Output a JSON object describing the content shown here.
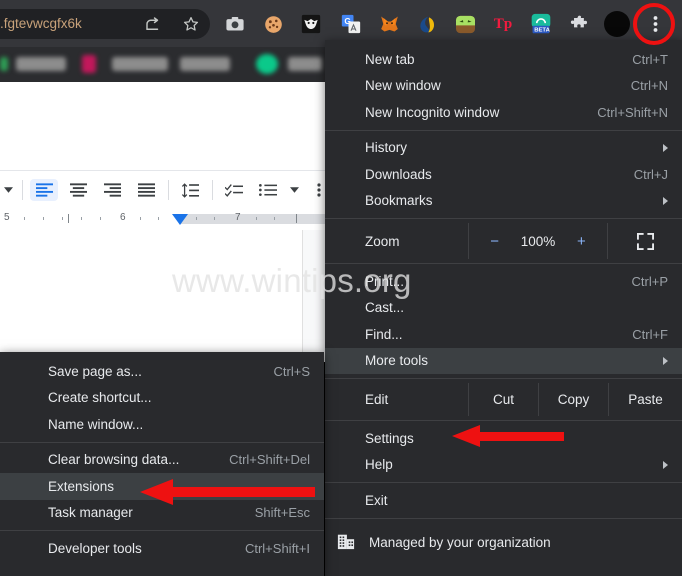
{
  "browser": {
    "omnibox_text": ".fgtevwcgfx6k",
    "toolbar_icons": [
      {
        "name": "share-icon",
        "glyph": "↪"
      },
      {
        "name": "bookmark-star-icon",
        "glyph": "☆"
      },
      {
        "name": "screenshot-camera-icon",
        "glyph": "▣"
      },
      {
        "name": "cookie-extension-icon",
        "glyph": "●"
      },
      {
        "name": "owl-extension-icon",
        "glyph": "▼"
      },
      {
        "name": "google-translate-icon",
        "glyph": "G"
      },
      {
        "name": "metamask-fox-icon",
        "glyph": "◆"
      },
      {
        "name": "wallet-extension-icon",
        "glyph": "◖"
      },
      {
        "name": "green-monster-extension-icon",
        "glyph": "▬"
      },
      {
        "name": "tp-extension-icon",
        "glyph": "Tp"
      },
      {
        "name": "beta-extension-icon",
        "glyph": "BETA"
      },
      {
        "name": "extensions-puzzle-icon",
        "glyph": "❖"
      },
      {
        "name": "profile-avatar-icon",
        "glyph": ""
      },
      {
        "name": "chrome-three-dot-menu-icon",
        "glyph": "⋮"
      }
    ]
  },
  "docs": {
    "toolbar_tools": [
      {
        "name": "align-left-button",
        "active": true
      },
      {
        "name": "align-center-button",
        "active": false
      },
      {
        "name": "align-right-button",
        "active": false
      },
      {
        "name": "justify-button",
        "active": false
      },
      {
        "name": "line-spacing-button",
        "active": false
      },
      {
        "name": "checklist-button",
        "active": false
      },
      {
        "name": "bulleted-list-button",
        "active": false
      }
    ],
    "ruler_marks": [
      "5",
      "6",
      "7"
    ]
  },
  "watermark": "www.wintips.org",
  "main_menu": {
    "groups": [
      {
        "items": [
          {
            "label": "New tab",
            "accel": "Ctrl+T",
            "submenu": false,
            "highlighted": false
          },
          {
            "label": "New window",
            "accel": "Ctrl+N",
            "submenu": false,
            "highlighted": false
          },
          {
            "label": "New Incognito window",
            "accel": "Ctrl+Shift+N",
            "submenu": false,
            "highlighted": false
          }
        ]
      },
      {
        "items": [
          {
            "label": "History",
            "accel": "",
            "submenu": true,
            "highlighted": false
          },
          {
            "label": "Downloads",
            "accel": "Ctrl+J",
            "submenu": false,
            "highlighted": false
          },
          {
            "label": "Bookmarks",
            "accel": "",
            "submenu": true,
            "highlighted": false
          }
        ]
      }
    ],
    "zoom_row": {
      "label": "Zoom",
      "minus": "−",
      "value": "100%",
      "plus": "+",
      "fullscreen_icon": "fullscreen-icon"
    },
    "group3": {
      "items": [
        {
          "label": "Print...",
          "accel": "Ctrl+P",
          "submenu": false,
          "highlighted": false
        },
        {
          "label": "Cast...",
          "accel": "",
          "submenu": false,
          "highlighted": false
        },
        {
          "label": "Find...",
          "accel": "Ctrl+F",
          "submenu": false,
          "highlighted": false
        },
        {
          "label": "More tools",
          "accel": "",
          "submenu": true,
          "highlighted": true
        }
      ]
    },
    "edit_row": {
      "edit": "Edit",
      "cut": "Cut",
      "copy": "Copy",
      "paste": "Paste"
    },
    "group4": {
      "items": [
        {
          "label": "Settings",
          "accel": "",
          "submenu": false,
          "highlighted": false
        },
        {
          "label": "Help",
          "accel": "",
          "submenu": true,
          "highlighted": false
        }
      ]
    },
    "group5": {
      "items": [
        {
          "label": "Exit",
          "accel": "",
          "submenu": false,
          "highlighted": false
        }
      ]
    },
    "managed": {
      "label": "Managed by your organization",
      "icon": "organization-building-icon"
    }
  },
  "sub_menu": {
    "groups": [
      {
        "items": [
          {
            "label": "Save page as...",
            "accel": "Ctrl+S",
            "highlighted": false
          },
          {
            "label": "Create shortcut...",
            "accel": "",
            "highlighted": false
          },
          {
            "label": "Name window...",
            "accel": "",
            "highlighted": false
          }
        ]
      },
      {
        "items": [
          {
            "label": "Clear browsing data...",
            "accel": "Ctrl+Shift+Del",
            "highlighted": false
          },
          {
            "label": "Extensions",
            "accel": "",
            "highlighted": true
          },
          {
            "label": "Task manager",
            "accel": "Shift+Esc",
            "highlighted": false
          }
        ]
      },
      {
        "items": [
          {
            "label": "Developer tools",
            "accel": "Ctrl+Shift+I",
            "highlighted": false
          }
        ]
      }
    ]
  },
  "annotations": {
    "accent_color": "#ee1111",
    "highlight_circle": "chrome-menu-button-highlight",
    "arrow_to_extensions": "arrow-pointing-to-extensions",
    "arrow_to_settings": "arrow-pointing-to-settings"
  }
}
